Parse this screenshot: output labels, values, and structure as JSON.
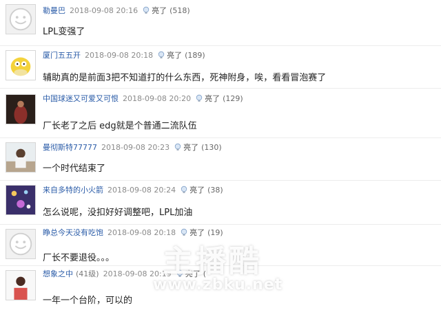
{
  "comments": [
    {
      "user": "勒曼巴",
      "level": "",
      "time": "2018-09-08 20:16",
      "like_label": "亮了",
      "like_count": "(518)",
      "text": "LPL变强了",
      "avatar": "default-avatar-icon"
    },
    {
      "user": "厦门五五开",
      "level": "",
      "time": "2018-09-08 20:18",
      "like_label": "亮了",
      "like_count": "(189)",
      "text": "辅助真的是前面3把不知道打的什么东西，死神附身，唉，看看冒泡赛了",
      "avatar": "psyduck-avatar"
    },
    {
      "user": "中国球迷又可爱又可恨",
      "level": "",
      "time": "2018-09-08 20:20",
      "like_label": "亮了",
      "like_count": "(129)",
      "text": "厂长老了之后 edg就是个普通二流队伍",
      "avatar": "figure-photo-avatar"
    },
    {
      "user": "曼彻斯特77777",
      "level": "",
      "time": "2018-09-08 20:23",
      "like_label": "亮了",
      "like_count": "(130)",
      "text": "一个时代结束了",
      "avatar": "girl-photo-avatar"
    },
    {
      "user": "来自多特的小火箭",
      "level": "",
      "time": "2018-09-08 20:24",
      "like_label": "亮了",
      "like_count": "(38)",
      "text": "怎么说呢，没扣好好调整吧，LPL加油",
      "avatar": "lights-photo-avatar"
    },
    {
      "user": "睁总今天没有吃饱",
      "level": "",
      "time": "2018-09-08 20:18",
      "like_label": "亮了",
      "like_count": "(19)",
      "text": "厂长不要退役。。。",
      "avatar": "default-avatar-icon"
    },
    {
      "user": "想象之中",
      "level": "(41级)",
      "time": "2018-09-08 20:19",
      "like_label": "亮了",
      "like_count": "(",
      "text": "一年一个台阶，可以的",
      "avatar": "woman-photo-avatar"
    }
  ],
  "watermark": {
    "logo": "主播酷",
    "url": "www.zbku.net"
  },
  "colors": {
    "username": "#2b5ca8",
    "time": "#8a8a8a",
    "text": "#222222"
  }
}
